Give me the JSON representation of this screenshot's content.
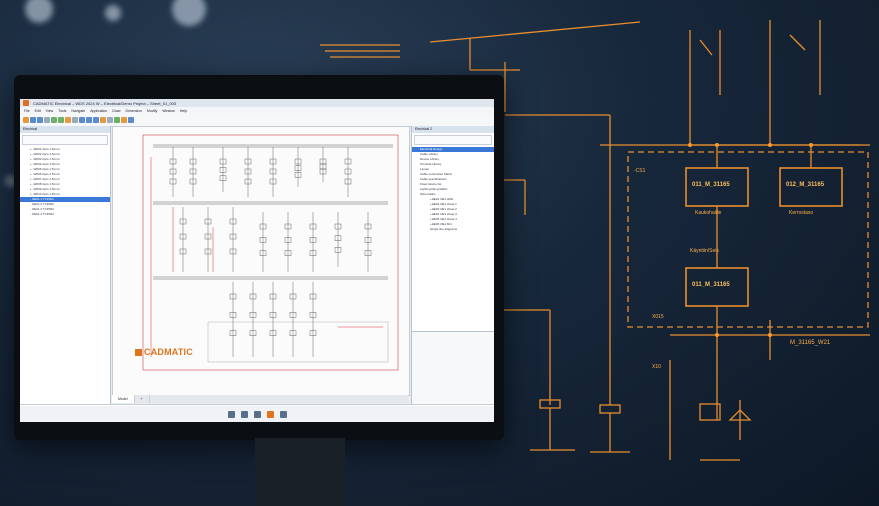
{
  "app": {
    "title": "CADMATIC Electrical – WDS 2024 W – Electrical/Demo Project – Sheet_01_003",
    "menu": [
      "File",
      "Edit",
      "View",
      "Tools",
      "Navigate",
      "Application",
      "Draw",
      "Dimension",
      "Modify",
      "Window",
      "Help"
    ],
    "left_panel_title": "Electrical",
    "right_panel_title": "Electrical 2",
    "tree_items": [
      "+ -W001 2pcs 1.5mm²",
      "+ -W002 2pcs 1.5mm²",
      "+ -W003 2pcs 1.5mm²",
      "+ -W004 2pcs 1.5mm²",
      "+ -W005 2pcs 1.5mm²",
      "+ -W006 2pcs 1.5mm²",
      "+ -W007 2pcs 1.5mm²",
      "+ -W008 2pcs 1.5mm²",
      "+ -W009 2pcs 1.5mm²",
      "+ -W010 2pcs 1.5mm²",
      "- OE01.1 TCP001",
      "- OE01.2 TCP002",
      "- OE01.3 TCP003",
      "- OE01.4 TCP004"
    ],
    "right_tree_items": [
      "Electrical Design",
      "Cable Library",
      "Device Library",
      "Terminal Library",
      "Layout",
      "Cable connection Matrix",
      "Cable specifications",
      "Fixed device list",
      "Lighting fitting Matrix",
      "Schematics",
      "+HE01 OE1 H8H",
      "+HE02 OE1 sheet 1",
      "+HE03 OE1 sheet 2",
      "+HE04 OE1 sheet 3",
      "+HE05 OE1 sheet 4",
      "+HE06 OE1 Mnt",
      "Single line diagrams"
    ],
    "tabs": [
      "Model",
      "+"
    ],
    "logo_text": "CADMATIC"
  },
  "overlay": {
    "boxes": [
      "011_M_31165",
      "012_M_31165",
      "011_M_31165"
    ],
    "labels": [
      "Kaukohalde",
      "Kerrostaso",
      "Käyntiin/Seis",
      "M_31165_W21",
      "-CS1",
      "X10",
      "X015"
    ]
  },
  "colors": {
    "accent": "#ff9a2e",
    "brand": "#e0731c"
  }
}
